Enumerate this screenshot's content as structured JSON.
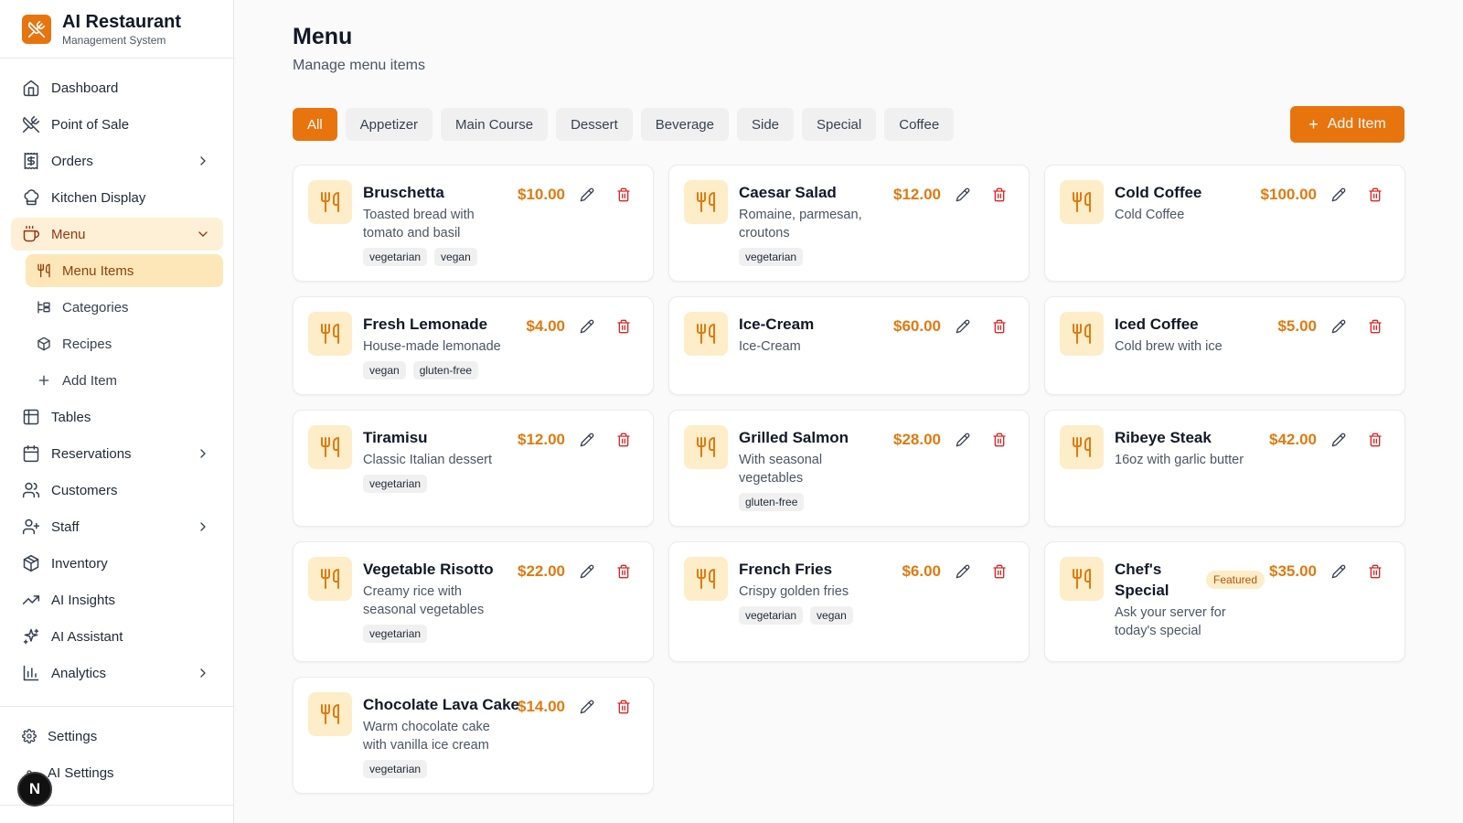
{
  "app": {
    "title": "AI Restaurant",
    "subtitle": "Management System"
  },
  "sidebar": {
    "items": [
      {
        "label": "Dashboard",
        "icon": "home-icon"
      },
      {
        "label": "Point of Sale",
        "icon": "utensils-crossed-icon"
      },
      {
        "label": "Orders",
        "icon": "receipt-icon",
        "expandable": true
      },
      {
        "label": "Kitchen Display",
        "icon": "chef-hat-icon"
      },
      {
        "label": "Menu",
        "icon": "coffee-icon",
        "expanded": true,
        "active": true
      },
      {
        "label": "Tables",
        "icon": "table-icon"
      },
      {
        "label": "Reservations",
        "icon": "calendar-icon",
        "expandable": true
      },
      {
        "label": "Customers",
        "icon": "users-icon"
      },
      {
        "label": "Staff",
        "icon": "user-plus-icon",
        "expandable": true
      },
      {
        "label": "Inventory",
        "icon": "package-icon"
      },
      {
        "label": "AI Insights",
        "icon": "trending-up-icon"
      },
      {
        "label": "AI Assistant",
        "icon": "sparkles-icon"
      },
      {
        "label": "Analytics",
        "icon": "bar-chart-icon",
        "expandable": true
      }
    ],
    "menu_subitems": [
      {
        "label": "Menu Items",
        "icon": "utensils-icon",
        "active": true
      },
      {
        "label": "Categories",
        "icon": "categories-icon"
      },
      {
        "label": "Recipes",
        "icon": "recipe-icon"
      },
      {
        "label": "Add Item",
        "icon": "plus-icon"
      }
    ],
    "bottom": [
      {
        "label": "Settings",
        "icon": "gear-icon"
      },
      {
        "label": "AI Settings",
        "icon": "ai-gear-icon"
      }
    ],
    "badge_letter": "N"
  },
  "page": {
    "title": "Menu",
    "subtitle": "Manage menu items"
  },
  "filters": [
    "All",
    "Appetizer",
    "Main Course",
    "Dessert",
    "Beverage",
    "Side",
    "Special",
    "Coffee"
  ],
  "active_filter": "All",
  "add_button": "Add Item",
  "items": [
    {
      "name": "Bruschetta",
      "desc": [
        "Toasted bread with",
        "tomato and basil"
      ],
      "price": "$10.00",
      "tags": [
        "vegetarian",
        "vegan"
      ]
    },
    {
      "name": "Caesar Salad",
      "desc": [
        "Romaine, parmesan,",
        "croutons"
      ],
      "price": "$12.00",
      "tags": [
        "vegetarian"
      ]
    },
    {
      "name": "Cold Coffee",
      "desc": [
        "Cold Coffee"
      ],
      "price": "$100.00",
      "tags": []
    },
    {
      "name": "Fresh Lemonade",
      "desc": [
        "House-made lemonade"
      ],
      "price": "$4.00",
      "tags": [
        "vegan",
        "gluten-free"
      ]
    },
    {
      "name": "Ice-Cream",
      "desc": [
        "Ice-Cream"
      ],
      "price": "$60.00",
      "tags": []
    },
    {
      "name": "Iced Coffee",
      "desc": [
        "Cold brew with ice"
      ],
      "price": "$5.00",
      "tags": []
    },
    {
      "name": "Tiramisu",
      "desc": [
        "Classic Italian dessert"
      ],
      "price": "$12.00",
      "tags": [
        "vegetarian"
      ]
    },
    {
      "name": "Grilled Salmon",
      "desc": [
        "With seasonal",
        "vegetables"
      ],
      "price": "$28.00",
      "tags": [
        "gluten-free"
      ]
    },
    {
      "name": "Ribeye Steak",
      "desc": [
        "16oz with garlic butter"
      ],
      "price": "$42.00",
      "tags": []
    },
    {
      "name": "Vegetable Risotto",
      "desc": [
        "Creamy rice with",
        "seasonal vegetables"
      ],
      "price": "$22.00",
      "tags": [
        "vegetarian"
      ]
    },
    {
      "name": "French Fries",
      "desc": [
        "Crispy golden fries"
      ],
      "price": "$6.00",
      "tags": [
        "vegetarian",
        "vegan"
      ]
    },
    {
      "name": "Chef's Special",
      "name_lines": [
        "Chef's",
        "Special"
      ],
      "desc": [
        "Ask your server for",
        "today's special"
      ],
      "price": "$35.00",
      "tags": [],
      "badge": "Featured"
    },
    {
      "name": "Chocolate Lava Cake",
      "desc": [
        "Warm chocolate cake",
        "with vanilla ice cream"
      ],
      "price": "$14.00",
      "tags": [
        "vegetarian"
      ]
    }
  ],
  "colors": {
    "accent": "#e8740e",
    "price": "#e07a0f",
    "delete": "#dc2626",
    "active_nav_bg": "#fef0d6",
    "icon_bg": "#fdedc8"
  }
}
